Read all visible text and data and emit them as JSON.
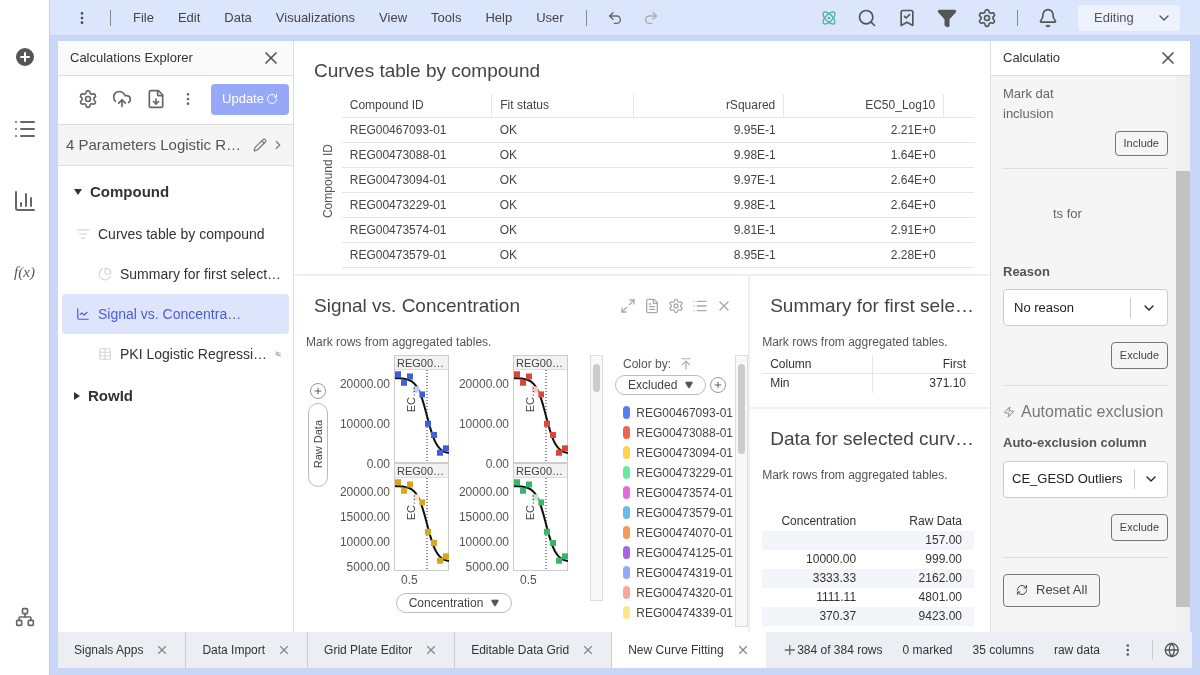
{
  "function_icon": "f(x)",
  "menu": [
    "File",
    "Edit",
    "Data",
    "Visualizations",
    "View",
    "Tools",
    "Help",
    "User"
  ],
  "mode": "Editing",
  "explorer": {
    "title": "Calculations Explorer",
    "update": "Update",
    "calculation": "4 Parameters Logistic R…",
    "tree": [
      {
        "label": "Compound",
        "expanded": true,
        "children": [
          {
            "label": "Curves table by compound",
            "kind": "sort",
            "selected": false,
            "children": [
              {
                "label": "Summary for first select…",
                "kind": "pie",
                "selected": false
              }
            ]
          },
          {
            "label": "Signal vs. Concentra…",
            "kind": "line",
            "selected": true,
            "children": [
              {
                "label": "PKI Logistic Regressi…",
                "kind": "grid",
                "selected": false,
                "hidden": true
              }
            ]
          }
        ]
      },
      {
        "label": "RowId",
        "expanded": false
      }
    ]
  },
  "curves_table": {
    "title": "Curves table by compound",
    "axis_label": "Compound ID",
    "columns": [
      "Compound ID",
      "Fit status",
      "rSquared",
      "EC50_Log10"
    ],
    "rows": [
      [
        "REG00467093-01",
        "OK",
        "9.95E-1",
        "2.21E+0"
      ],
      [
        "REG00473088-01",
        "OK",
        "9.98E-1",
        "1.64E+0"
      ],
      [
        "REG00473094-01",
        "OK",
        "9.97E-1",
        "2.64E+0"
      ],
      [
        "REG00473229-01",
        "OK",
        "9.98E-1",
        "2.64E+0"
      ],
      [
        "REG00473574-01",
        "OK",
        "9.81E-1",
        "2.91E+0"
      ],
      [
        "REG00473579-01",
        "OK",
        "8.95E-1",
        "2.28E+0"
      ]
    ]
  },
  "signal_panel": {
    "title": "Signal vs. Concentration",
    "note": "Mark rows from aggregated tables.",
    "y_axis": "Raw Data",
    "x_axis": "Concentration",
    "rows": [
      {
        "plots": [
          {
            "yticks": [
              "20000.00",
              "10000.00",
              "0.00"
            ],
            "title": "REG00…",
            "ec_label": "EC…",
            "color": "#3f5fd6"
          },
          {
            "yticks": [
              "20000.00",
              "10000.00",
              "0.00"
            ],
            "title": "REG00…",
            "ec_label": "EC…",
            "color": "#d9473a"
          }
        ]
      },
      {
        "plots": [
          {
            "yticks": [
              "20000.00",
              "15000.00",
              "10000.00",
              "5000.00"
            ],
            "title": "REG00…",
            "ec_label": "EC…",
            "color": "#d6a822"
          },
          {
            "yticks": [
              "20000.00",
              "15000.00",
              "10000.00",
              "5000.00"
            ],
            "title": "REG00…",
            "ec_label": "EC…",
            "color": "#3bb56b"
          }
        ]
      }
    ],
    "xticks": [
      "0.5",
      "0.5"
    ],
    "legend": {
      "label": "Color by:",
      "column": "Excluded",
      "items": [
        {
          "label": "REG00467093-01",
          "color": "#5b7cf0"
        },
        {
          "label": "REG00473088-01",
          "color": "#ee6352"
        },
        {
          "label": "REG00473094-01",
          "color": "#fcd34d"
        },
        {
          "label": "REG00473229-01",
          "color": "#6ee7a0"
        },
        {
          "label": "REG00473574-01",
          "color": "#e66ad8"
        },
        {
          "label": "REG00473579-01",
          "color": "#6bb8ea"
        },
        {
          "label": "REG00474070-01",
          "color": "#f59a5b"
        },
        {
          "label": "REG00474125-01",
          "color": "#a963e6"
        },
        {
          "label": "REG00474319-01",
          "color": "#93aaf8"
        },
        {
          "label": "REG00474320-01",
          "color": "#f8a89c"
        },
        {
          "label": "REG00474339-01",
          "color": "#fde68a"
        }
      ]
    }
  },
  "summary": {
    "title": "Summary for first sele…",
    "note": "Mark rows from aggregated tables.",
    "columns": [
      "Column",
      "First"
    ],
    "rows": [
      [
        "Min",
        "371.10"
      ]
    ]
  },
  "data_table": {
    "title": "Data for selected curv…",
    "note": "Mark rows from aggregated tables.",
    "columns": [
      "Concentration",
      "Raw Data"
    ],
    "rows": [
      {
        "raw": "157.00"
      },
      {
        "concentration": "10000.00",
        "raw": "999.00"
      },
      {
        "concentration": "3333.33",
        "raw": "2162.00"
      },
      {
        "concentration": "1111.11",
        "raw": "4801.00"
      },
      {
        "concentration": "370.37",
        "raw": "9423.00"
      }
    ]
  },
  "details": {
    "title": "Calculatio",
    "intro_1": "Mark dat",
    "intro_2": "inclusion",
    "include": "Include",
    "fragment": "ts for",
    "reason_label": "Reason",
    "reason": "No reason",
    "exclude": "Exclude",
    "auto_title": "Automatic exclusion",
    "auto_label": "Auto-exclusion column",
    "auto_value": "CE_GESD Outliers",
    "auto_exclude": "Exclude",
    "reset": "Reset All"
  },
  "tabs": [
    {
      "label": "Signals Apps",
      "selected": false
    },
    {
      "label": "Data Import",
      "selected": false
    },
    {
      "label": "Grid Plate Editor",
      "selected": false
    },
    {
      "label": "Editable Data Grid",
      "selected": false
    },
    {
      "label": "New Curve Fitting",
      "selected": true
    }
  ],
  "status": [
    "384 of 384 rows",
    "0 marked",
    "35 columns",
    "raw data"
  ]
}
